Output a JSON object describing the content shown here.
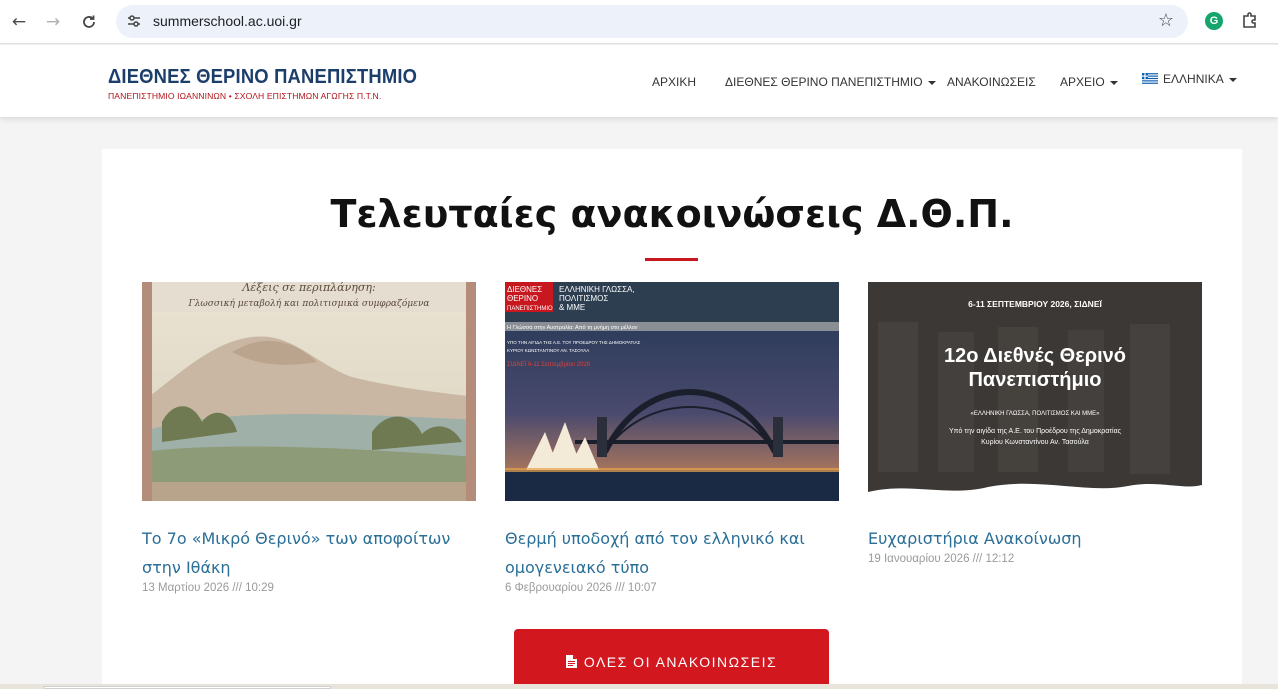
{
  "browser": {
    "url": "summerschool.ac.uoi.gr",
    "back_icon": "arrow-left-icon",
    "forward_icon": "arrow-right-icon",
    "reload_icon": "reload-icon",
    "site_info_icon": "tune-icon",
    "bookmark_icon": "star-outline-icon",
    "extension_g_label": "G",
    "extensions_icon": "puzzle-icon"
  },
  "site": {
    "logo_title": "ΔΙΕΘΝΕΣ ΘΕΡΙΝΟ ΠΑΝΕΠΙΣΤΗΜΙΟ",
    "logo_subtitle": "ΠΑΝΕΠΙΣΤΗΜΙΟ ΙΩΑΝΝΙΝΩΝ • ΣΧΟΛΗ ΕΠΙΣΤΗΜΩΝ ΑΓΩΓΗΣ Π.Τ.Ν.",
    "brand_color": "#1c3e6b",
    "accent_color": "#c8171e",
    "nav": {
      "home": "ΑΡΧΙΚΗ",
      "summer_school": "ΔΙΕΘΝΕΣ ΘΕΡΙΝΟ ΠΑΝΕΠΙΣΤΗΜΙΟ",
      "announcements": "ΑΝΑΚΟΙΝΩΣΕΙΣ",
      "archive": "ΑΡΧΕΙΟ",
      "language": "ΕΛΛΗΝΙΚΑ"
    }
  },
  "main": {
    "section_title": "Τελευταίες ανακοινώσεις Δ.Θ.Π.",
    "news": [
      {
        "title": "Το 7ο «Μικρό Θερινό» των αποφοίτων στην Ιθάκη",
        "date": "13 Μαρτίου 2026 /// 10:29",
        "image_lines": [
          "Λέξεις σε περιπλάνηση:",
          "Γλωσσική μεταβολή και πολιτισμικά συμφραζόμενα"
        ]
      },
      {
        "title": "Θερμή υποδοχή από τον ελληνικό και ομογενειακό τύπο",
        "date": "6 Φεβρουαρίου 2026 /// 10:07",
        "image_lines": [
          "ΔΙΕΘΝΕΣ",
          "ΘΕΡΙΝΟ",
          "ΠΑΝΕΠΙΣΤΗΜΙΟ",
          "ΕΛΛΗΝΙΚΗ ΓΛΩΣΣΑ,",
          "ΠΟΛΙΤΙΣΜΟΣ",
          "& ΜΜΕ",
          "Η Γλώσσα στην Αυστραλία: Από τη μνήμη στο μέλλον",
          "ΥΠΟ ΤΗΝ ΑΙΓΙΔΑ ΤΗΣ Α.Ε. ΤΟΥ ΠΡΟΕΔΡΟΥ ΤΗΣ ΔΗΜΟΚΡΑΤΙΑΣ",
          "ΚΥΡΙΟΥ ΚΩΝΣΤΑΝΤΙΝΟΥ ΑΝ. ΤΑΣΟΥΛΑ",
          "ΣΙΔΝΕΪ 6-11 Σεπτεμβρίου 2026"
        ]
      },
      {
        "title": "Ευχαριστήρια Ανακοίνωση",
        "date": "19 Ιανουαρίου 2026 /// 12:12",
        "image_lines": [
          "6-11 ΣΕΠΤΕΜΒΡΙΟΥ 2026, ΣΙΔΝΕΪ",
          "12ο Διεθνές Θερινό",
          "Πανεπιστήμιο",
          "«ΕΛΛΗΝΙΚΗ ΓΛΩΣΣΑ, ΠΟΛΙΤΙΣΜΟΣ ΚΑΙ ΜΜΕ»",
          "Υπό την αιγίδα της Α.Ε. του Προέδρου της Δημοκρατίας",
          "Κυρίου Κωνσταντίνου Αν. Τασούλα"
        ]
      }
    ],
    "all_button_label": "ΟΛΕΣ ΟΙ ΑΝΑΚΟΙΝΩΣΕΙΣ",
    "all_button_icon": "document-icon"
  }
}
